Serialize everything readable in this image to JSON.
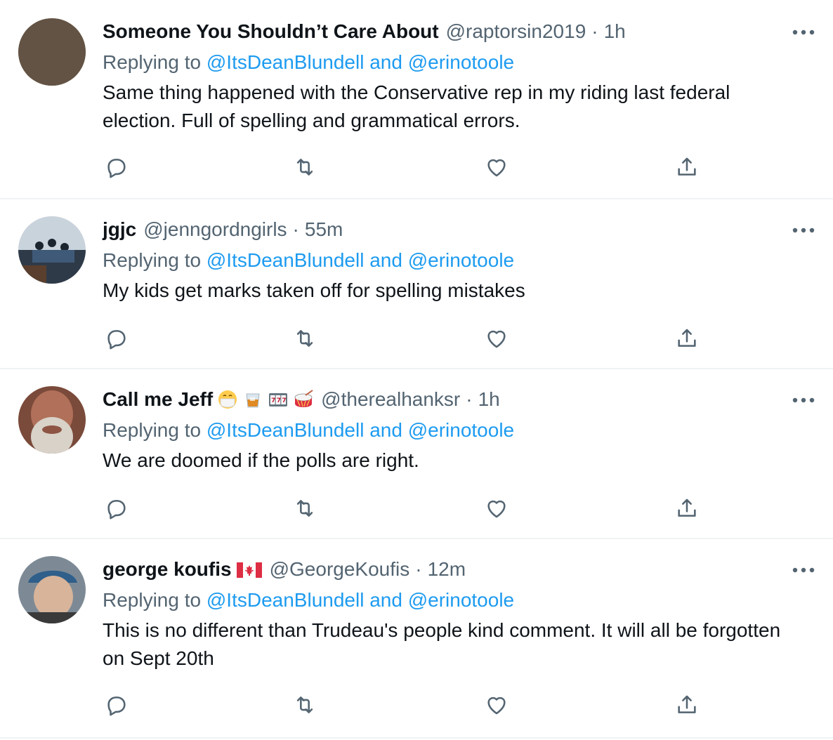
{
  "replying_prefix": "Replying to",
  "tweets": [
    {
      "name": "Someone You Shouldn’t Care About",
      "handle": "@raptorsin2019",
      "time": "1h",
      "mentions": [
        "@ItsDeanBlundell",
        "@erinotoole"
      ],
      "text": "Same thing happened with the Conservative rep in my riding last federal election. Full of spelling and grammatical errors."
    },
    {
      "name": "jgjc",
      "handle": "@jenngordngirls",
      "time": "55m",
      "mentions": [
        "@ItsDeanBlundell",
        "@erinotoole"
      ],
      "text": "My kids get marks taken off for spelling mistakes"
    },
    {
      "name": "Call me Jeff",
      "handle": "@therealhanksr",
      "time": "1h",
      "emojis": [
        "mask-emoji",
        "whiskey-glass-emoji",
        "slot-machine-emoji",
        "drum-emoji"
      ],
      "mentions": [
        "@ItsDeanBlundell",
        "@erinotoole"
      ],
      "text": "We are doomed if the polls are right."
    },
    {
      "name": "george koufis",
      "handle": "@GeorgeKoufis",
      "time": "12m",
      "emojis": [
        "canada-flag-emoji"
      ],
      "mentions": [
        "@ItsDeanBlundell",
        "@erinotoole"
      ],
      "text": "This is no different than Trudeau's people kind  comment. It will all be forgotten on Sept 20th"
    }
  ],
  "separators": {
    "dot": "·",
    "and": "and"
  },
  "colors": {
    "text": "#0f1419",
    "muted": "#536471",
    "link": "#1d9bf0",
    "divider": "#eff3f4"
  }
}
